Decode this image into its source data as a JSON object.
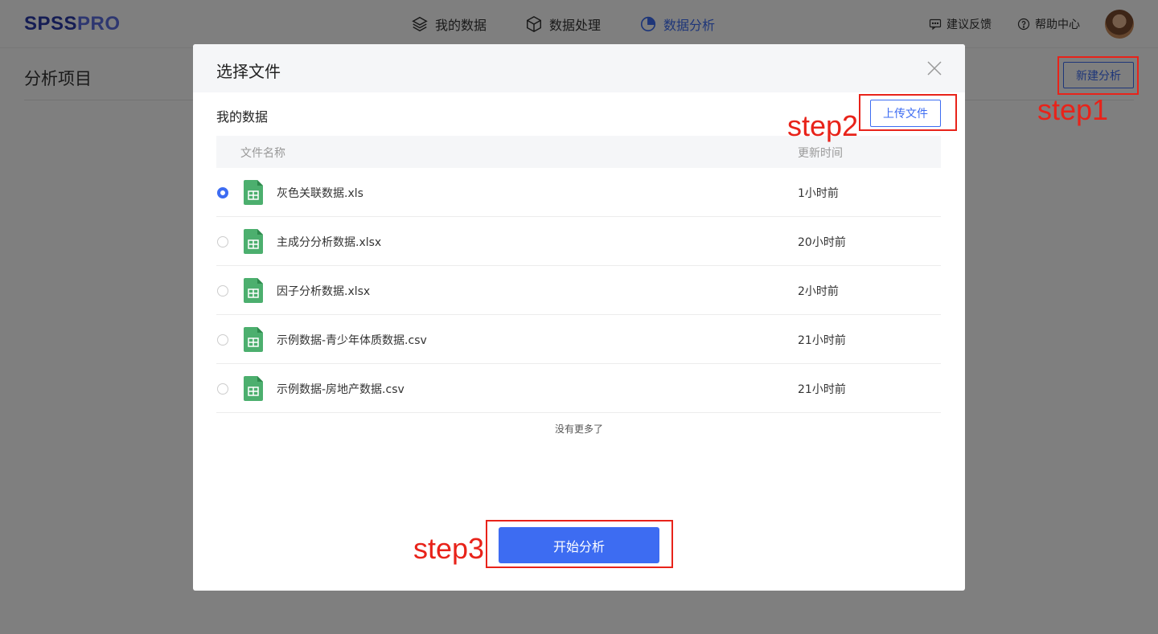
{
  "app": {
    "logo_part1": "SPSS",
    "logo_part2": "PRO"
  },
  "nav": {
    "items": [
      {
        "label": "我的数据",
        "icon": "layers-icon"
      },
      {
        "label": "数据处理",
        "icon": "cube-icon"
      },
      {
        "label": "数据分析",
        "icon": "pie-chart-icon",
        "active": true
      }
    ],
    "feedback": "建议反馈",
    "help": "帮助中心"
  },
  "page": {
    "title": "分析项目",
    "new_analysis": "新建分析"
  },
  "modal": {
    "title": "选择文件",
    "section_label": "我的数据",
    "upload_label": "上传文件",
    "columns": {
      "name": "文件名称",
      "time": "更新时间"
    },
    "files": [
      {
        "name": "灰色关联数据.xls",
        "time": "1小时前",
        "selected": true
      },
      {
        "name": "主成分分析数据.xlsx",
        "time": "20小时前",
        "selected": false
      },
      {
        "name": "因子分析数据.xlsx",
        "time": "2小时前",
        "selected": false
      },
      {
        "name": "示例数据-青少年体质数据.csv",
        "time": "21小时前",
        "selected": false
      },
      {
        "name": "示例数据-房地产数据.csv",
        "time": "21小时前",
        "selected": false
      }
    ],
    "no_more": "没有更多了",
    "start_label": "开始分析"
  },
  "annotations": {
    "step1": "step1",
    "step2": "step2",
    "step3": "step3"
  },
  "colors": {
    "accent": "#3d6cf2",
    "annotation": "#e8231a",
    "file_icon": "#4caf6e"
  }
}
